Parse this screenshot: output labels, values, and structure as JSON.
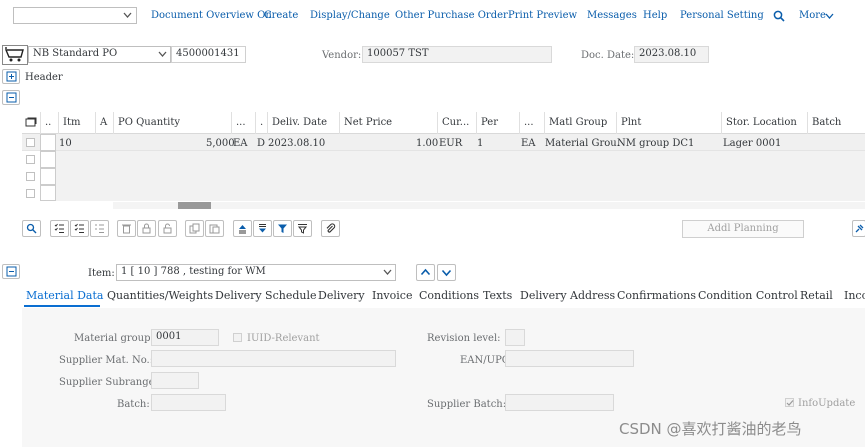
{
  "menu": {
    "items": [
      "Document Overview On",
      "Create",
      "Display/Change",
      "Other Purchase Order",
      "Print Preview",
      "Messages",
      "Help",
      "Personal Setting"
    ],
    "more": "More"
  },
  "header_row": {
    "doc_type": "NB Standard PO",
    "po_number": "4500001431",
    "vendor_label": "Vendor:",
    "vendor_value": "100057 TST",
    "doc_date_label": "Doc. Date:",
    "doc_date_value": "2023.08.10",
    "header_label": "Header"
  },
  "grid": {
    "columns": [
      "..",
      "Itm",
      "A",
      "PO Quantity",
      "...",
      ".",
      "Deliv. Date",
      "Net Price",
      "Cur...",
      "Per",
      "...",
      "Matl Group",
      "Plnt",
      "Stor. Location",
      "Batch"
    ],
    "row": {
      "itm": "10",
      "qty": "5,000",
      "unit": "EA",
      "d": "D",
      "deliv_date": "2023.08.10",
      "net_price": "1.00",
      "currency": "EUR",
      "per": "1",
      "oun": "EA",
      "matl_group": "Material Grou.",
      "plant": "NM group DC1",
      "stor_loc": "Lager 0001"
    }
  },
  "toolbar": {
    "addl_planning": "Addl Planning"
  },
  "item": {
    "label": "Item:",
    "value": "1 [ 10 ] 788 , testing for WM"
  },
  "tabs": [
    "Material Data",
    "Quantities/Weights",
    "Delivery Schedule",
    "Delivery",
    "Invoice",
    "Conditions",
    "Texts",
    "Delivery Address",
    "Confirmations",
    "Condition Control",
    "Retail",
    "Inco"
  ],
  "form": {
    "material_group_label": "Material group:",
    "material_group_value": "0001",
    "iuid_label": "IUID-Relevant",
    "revision_label": "Revision level:",
    "supplier_mat_label": "Supplier Mat. No.:",
    "ean_label": "EAN/UPC:",
    "supplier_subrange_label": "Supplier Subrange:",
    "batch_label": "Batch:",
    "supplier_batch_label": "Supplier Batch:",
    "infoupdate_label": "InfoUpdate"
  },
  "watermark": "CSDN @喜欢打酱油的老鸟"
}
